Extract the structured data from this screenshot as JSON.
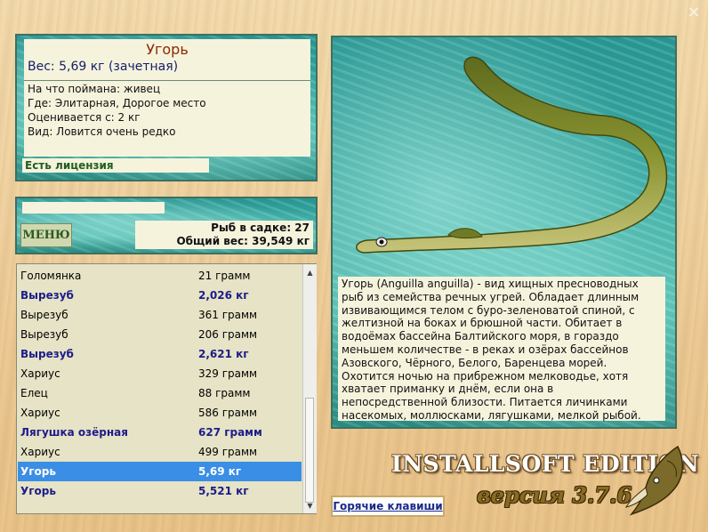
{
  "close_label": "×",
  "catch": {
    "name": "Угорь",
    "weight": "Вес: 5,69 кг (зачетная)",
    "bait": "На что поймана: живец",
    "place": "Где: Элитарная, Дорогое место",
    "valued_from": "Оценивается с: 2 кг",
    "species_rarity": "Вид: Ловится очень редко",
    "license": "Есть лицензия"
  },
  "menu_label": "МЕНЮ",
  "keepnet": {
    "fish_count": "Рыб в садке: 27",
    "total_weight": "Общий вес: 39,549 кг"
  },
  "catch_list": [
    {
      "name": "Голомянка",
      "weight": "21 грамм",
      "style": "normal"
    },
    {
      "name": "Вырезуб",
      "weight": "2,026 кг",
      "style": "bold"
    },
    {
      "name": "Вырезуб",
      "weight": "361 грамм",
      "style": "normal"
    },
    {
      "name": "Вырезуб",
      "weight": "206 грамм",
      "style": "normal"
    },
    {
      "name": "Вырезуб",
      "weight": "2,621 кг",
      "style": "bold"
    },
    {
      "name": "Хариус",
      "weight": "329 грамм",
      "style": "normal"
    },
    {
      "name": "Елец",
      "weight": "88 грамм",
      "style": "normal"
    },
    {
      "name": "Хариус",
      "weight": "586 грамм",
      "style": "normal"
    },
    {
      "name": "Лягушка озёрная",
      "weight": "627 грамм",
      "style": "bold"
    },
    {
      "name": "Хариус",
      "weight": "499 грамм",
      "style": "normal"
    },
    {
      "name": "Угорь",
      "weight": "5,69 кг",
      "style": "selected"
    },
    {
      "name": "Угорь",
      "weight": "5,521 кг",
      "style": "bold"
    }
  ],
  "description": "Угорь (Anguilla anguilla) - вид хищных пресноводных рыб из семейства речных угрей. Обладает длинным извивающимся телом с буро-зеленоватой спиной, с желтизной на боках и брюшной части. Обитает в водоёмах бассейна Балтийского моря, в гораздо меньшем количестве - в реках и озёрах бассейнов Азовского, Чёрного, Белого, Баренцева морей. Охотится ночью на прибрежном мелководье, хотя хватает приманку и днём, если она в непосредственной близости. Питается личинками насекомых, моллюсками, лягушками, мелкой рыбой.",
  "hotkeys_label": "Горячие клавиши",
  "brand": "INSTALLSOFT EDITION",
  "version": "версия 3.7.6",
  "icons": [
    "close-icon",
    "eel-image",
    "pike-logo-icon",
    "scroll-up-icon",
    "scroll-down-icon"
  ]
}
